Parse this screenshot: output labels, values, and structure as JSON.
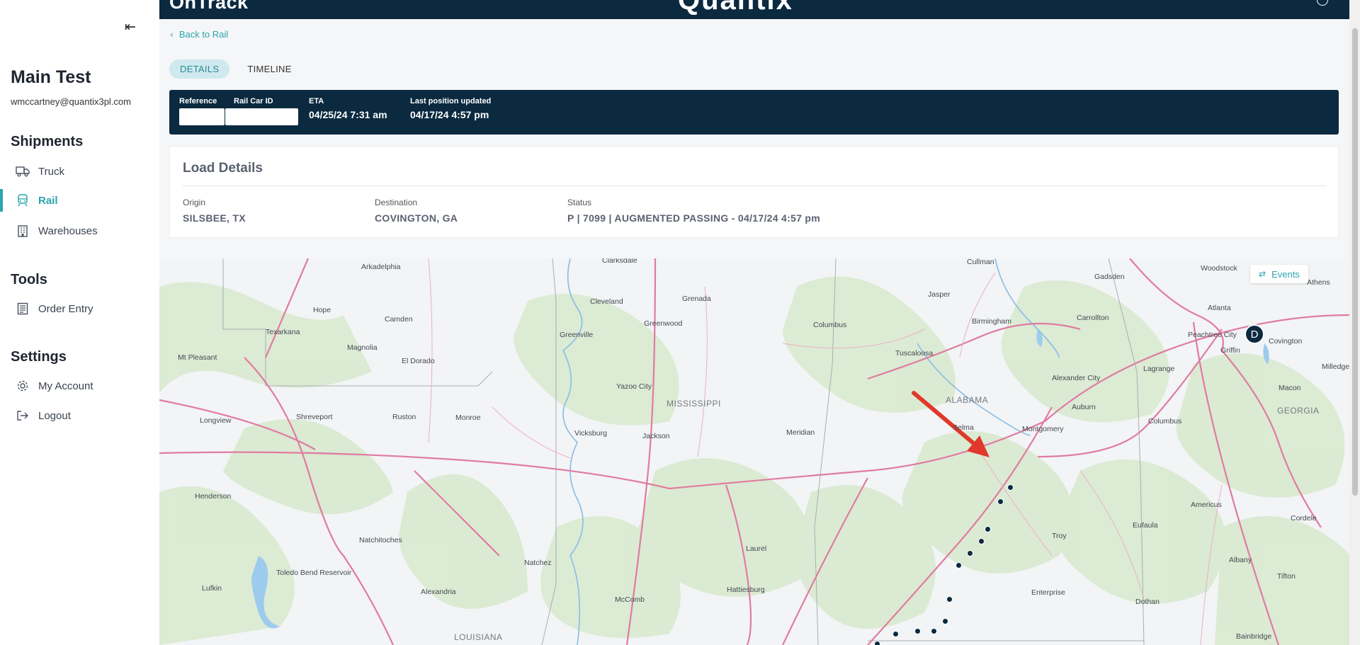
{
  "sidebar": {
    "collapse_icon": "collapse-left-icon",
    "user_name": "Main Test",
    "user_email": "wmccartney@quantix3pl.com",
    "sections": {
      "shipments": "Shipments",
      "tools": "Tools",
      "settings": "Settings"
    },
    "items": {
      "truck": {
        "label": "Truck",
        "icon": "truck-icon"
      },
      "rail": {
        "label": "Rail",
        "icon": "train-icon",
        "active": true
      },
      "warehouses": {
        "label": "Warehouses",
        "icon": "building-icon"
      },
      "order_entry": {
        "label": "Order Entry",
        "icon": "list-icon"
      },
      "my_account": {
        "label": "My Account",
        "icon": "gear-icon"
      },
      "logout": {
        "label": "Logout",
        "icon": "logout-icon"
      }
    }
  },
  "header": {
    "brand_left": "OnTrack",
    "brand_center": "Quantix"
  },
  "back_link": "Back to Rail",
  "tabs": [
    {
      "label": "DETAILS",
      "active": true
    },
    {
      "label": "TIMELINE",
      "active": false
    }
  ],
  "info_bar": {
    "reference_label": "Reference",
    "reference_value": "",
    "rail_car_label": "Rail Car ID",
    "rail_car_value": "",
    "eta_label": "ETA",
    "eta_value": "04/25/24 7:31 am",
    "last_pos_label": "Last position updated",
    "last_pos_value": "04/17/24 4:57 pm"
  },
  "load_details": {
    "title": "Load Details",
    "origin_label": "Origin",
    "origin_value": "SILSBEE, TX",
    "destination_label": "Destination",
    "destination_value": "COVINGTON, GA",
    "status_label": "Status",
    "status_value": "P | 7099 | AUGMENTED PASSING - 04/17/24 4:57 pm"
  },
  "map": {
    "events_button": "Events",
    "destination_marker": "D",
    "states": [
      "MISSISSIPPI",
      "ALABAMA",
      "GEORGIA",
      "LOUISIANA"
    ],
    "cities": [
      "Clarksdale",
      "Cullman",
      "Woodstock",
      "Gadsden",
      "Athens",
      "Arkadelphia",
      "Jasper",
      "Atlanta",
      "Cleveland",
      "Grenada",
      "Covington",
      "Hope",
      "Camden",
      "Greenwood",
      "Birmingham",
      "Carrollton",
      "Greenville",
      "Columbus",
      "Peachtree City",
      "Texarkana",
      "Griffin",
      "Magnolia",
      "Mt Pleasant",
      "El Dorado",
      "Tuscaloosa",
      "Milledgev",
      "Lagrange",
      "Yazoo City",
      "Alexander City",
      "Macon",
      "Longview",
      "Shreveport",
      "Ruston",
      "Monroe",
      "Auburn",
      "Columbus",
      "Vicksburg",
      "Jackson",
      "Meridian",
      "Selma",
      "Montgomery",
      "Henderson",
      "Americus",
      "Cordele",
      "Troy",
      "Natchitoches",
      "Eufaula",
      "Laurel",
      "Natchez",
      "Albany",
      "Lufkin",
      "Toledo Bend Reservoir",
      "Alexandria",
      "McComb",
      "Hattiesburg",
      "Enterprise",
      "Dothan",
      "Tifton",
      "Bainbridge"
    ]
  },
  "colors": {
    "navy": "#0b2a40",
    "accent": "#2aa4ae",
    "road": "#e07ba1",
    "water": "#7bb8e0",
    "forest": "#d6e8c8"
  }
}
